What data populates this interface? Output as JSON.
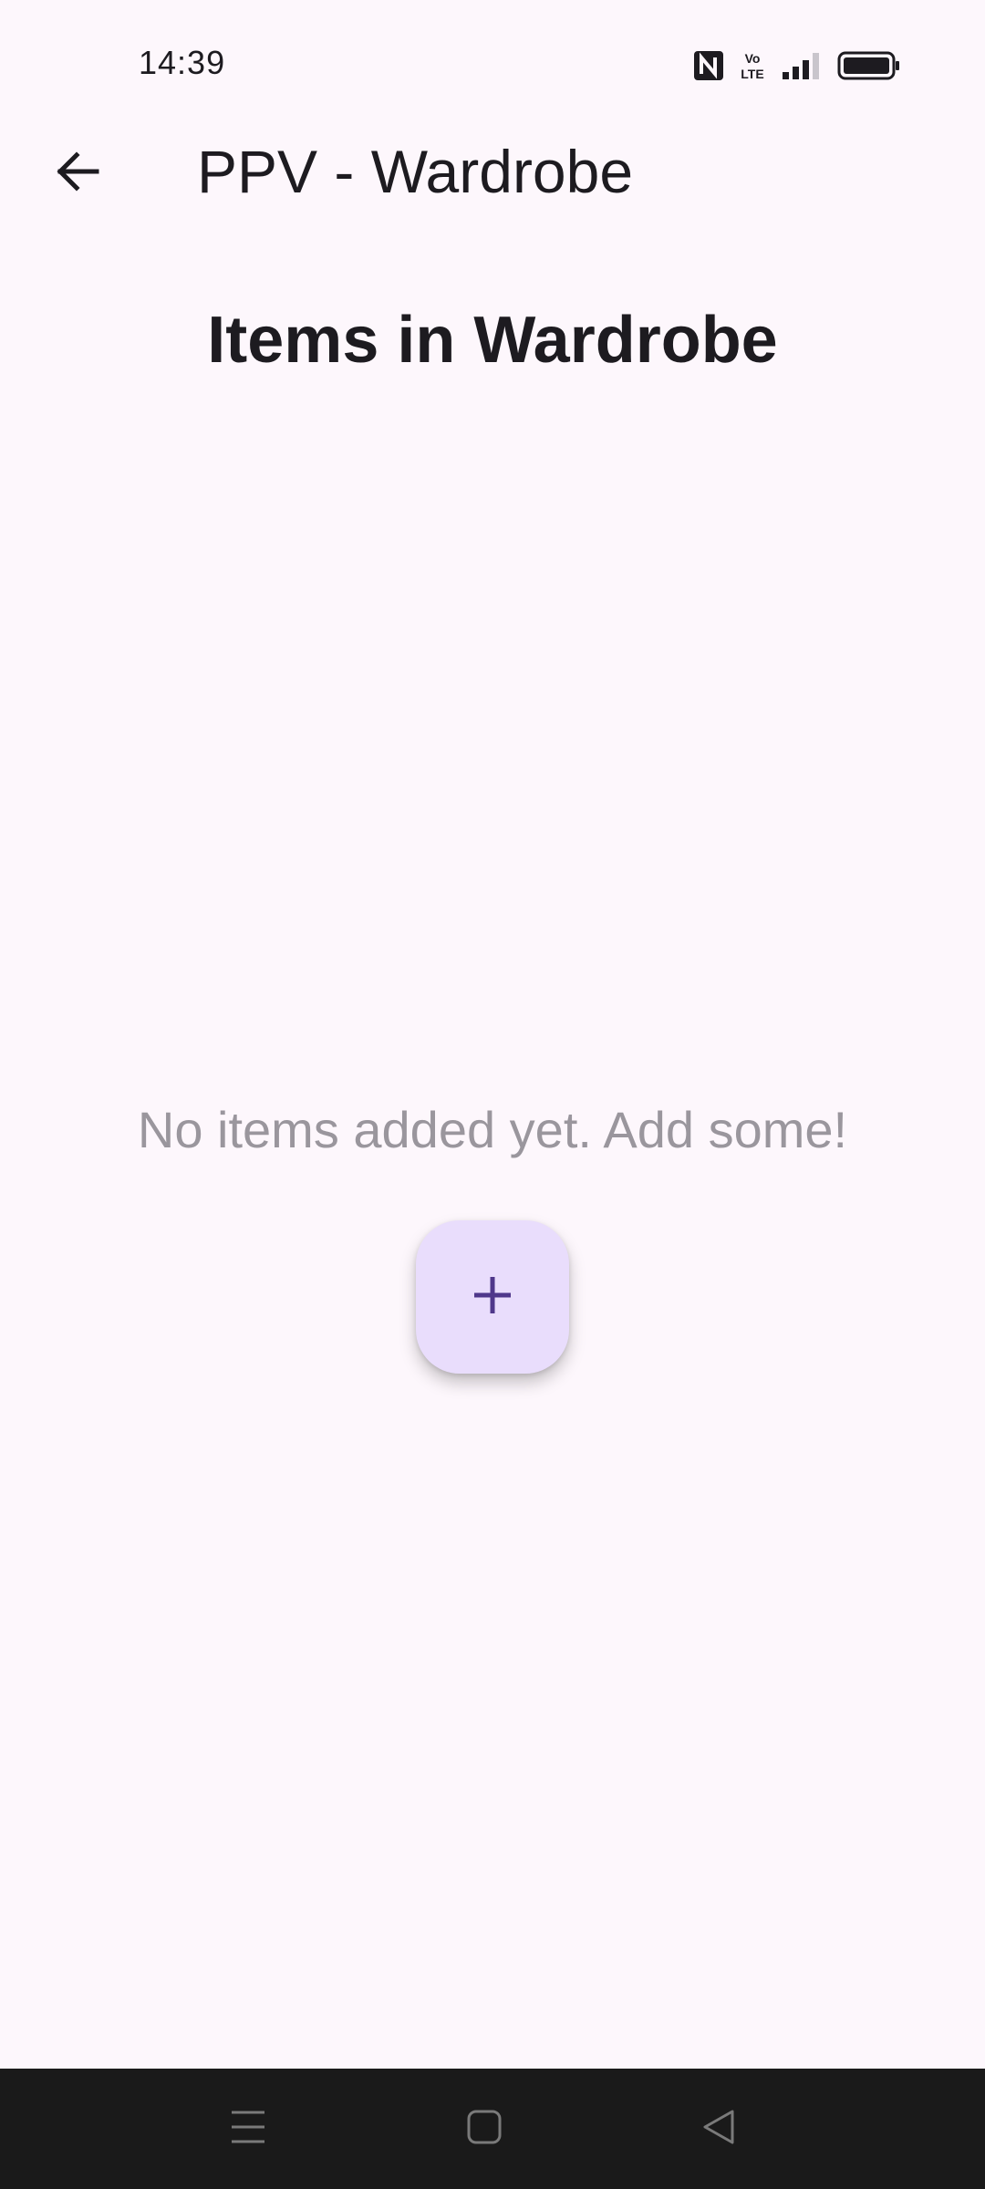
{
  "status_bar": {
    "time": "14:39",
    "icons": [
      "nfc-icon",
      "volte-icon",
      "signal-icon",
      "battery-icon"
    ]
  },
  "app_bar": {
    "title": "PPV - Wardrobe",
    "back_icon": "arrow-left-icon"
  },
  "main": {
    "heading": "Items in Wardrobe",
    "empty_message": "No items added yet. Add some!",
    "fab_icon": "plus-icon"
  },
  "nav_bar": {
    "buttons": [
      "menu-icon",
      "home-icon",
      "back-triangle-icon"
    ]
  },
  "colors": {
    "background": "#fdf7fc",
    "fab_background": "#e9ddfc",
    "fab_icon": "#4f378b",
    "empty_text": "#9a969d",
    "nav_bar": "#1a1a1a"
  }
}
